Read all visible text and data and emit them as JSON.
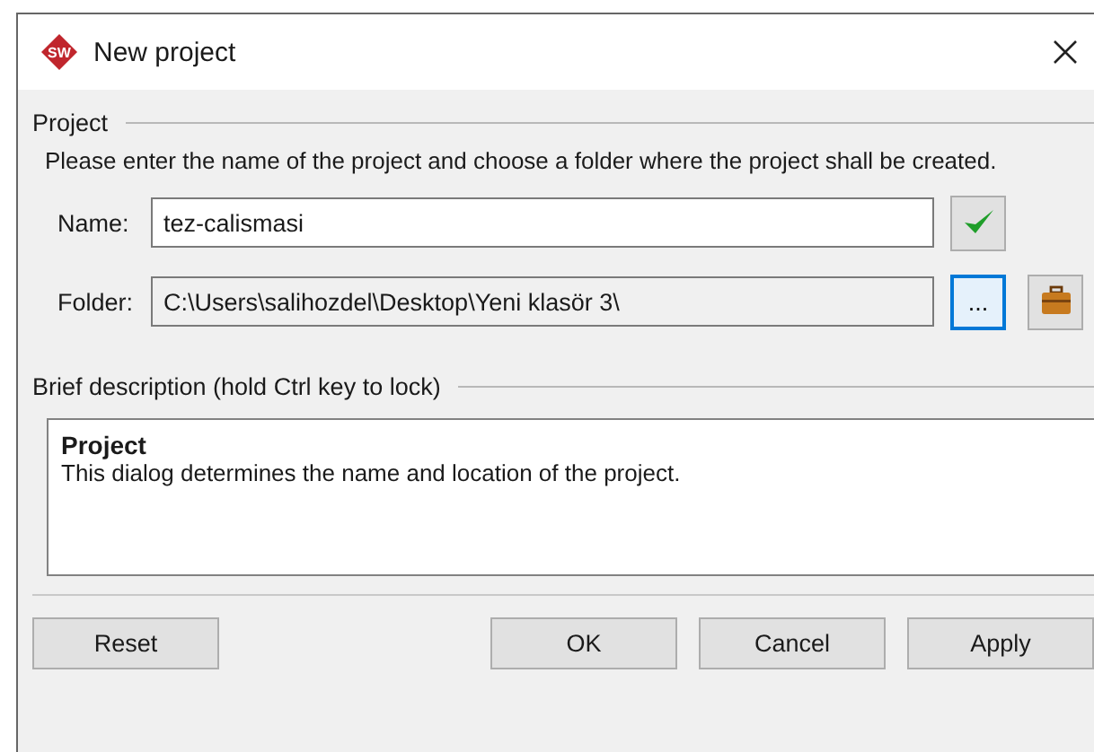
{
  "window": {
    "title": "New project",
    "logo": "SW"
  },
  "project_group": {
    "label": "Project",
    "instructions": "Please enter the name of the project and choose a folder where the project shall be created.",
    "name": {
      "label": "Name:",
      "value": "tez-calismasi",
      "valid": true
    },
    "folder": {
      "label": "Folder:",
      "value": "C:\\Users\\salihozdel\\Desktop\\Yeni klasör 3\\",
      "browse_label": "..."
    }
  },
  "description_group": {
    "label": "Brief description (hold Ctrl key to lock)",
    "heading": "Project",
    "text": "This dialog determines the name and location of the project."
  },
  "buttons": [
    {
      "label": "Reset",
      "kind": "left"
    },
    {
      "label": "OK",
      "kind": "right"
    },
    {
      "label": "Cancel",
      "kind": "right"
    },
    {
      "label": "Apply",
      "kind": "right"
    }
  ]
}
